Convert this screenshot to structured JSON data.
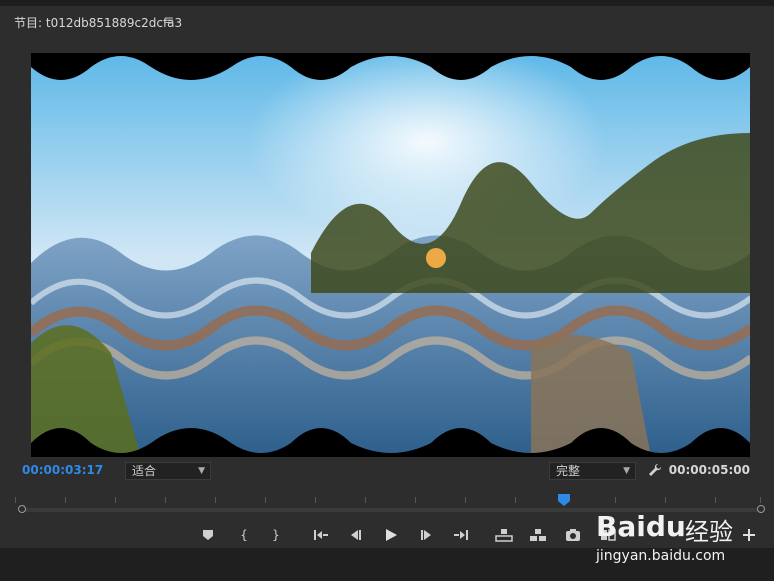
{
  "panel": {
    "title": "节目: t012db851889c2dcfa3",
    "menu_icon": "hamburger-icon"
  },
  "timecode": {
    "current": "00:00:03:17",
    "duration": "00:00:05:00"
  },
  "zoom_select": {
    "value": "适合"
  },
  "quality_select": {
    "value": "完整"
  },
  "playhead_progress": 0.74,
  "transport": [
    {
      "name": "add-marker-button",
      "icon": "marker-icon"
    },
    {
      "name": "mark-in-button",
      "icon": "mark-in-icon",
      "glyph": "{"
    },
    {
      "name": "mark-out-button",
      "icon": "mark-out-icon",
      "glyph": "}"
    },
    {
      "name": "go-to-in-button",
      "icon": "go-to-in-icon"
    },
    {
      "name": "step-back-button",
      "icon": "step-back-icon"
    },
    {
      "name": "play-button",
      "icon": "play-icon"
    },
    {
      "name": "step-forward-button",
      "icon": "step-forward-icon"
    },
    {
      "name": "go-to-out-button",
      "icon": "go-to-out-icon"
    },
    {
      "name": "lift-button",
      "icon": "lift-icon"
    },
    {
      "name": "extract-button",
      "icon": "extract-icon"
    },
    {
      "name": "export-frame-button",
      "icon": "camera-icon"
    },
    {
      "name": "compare-button",
      "icon": "compare-icon"
    },
    {
      "name": "add-button",
      "icon": "plus-icon"
    }
  ],
  "watermark": {
    "brand": "Baidu",
    "brand_cn": "经验",
    "url": "jingyan.baidu.com"
  },
  "colors": {
    "accent": "#2e8ae6",
    "panel_bg": "#2d2d2d"
  }
}
